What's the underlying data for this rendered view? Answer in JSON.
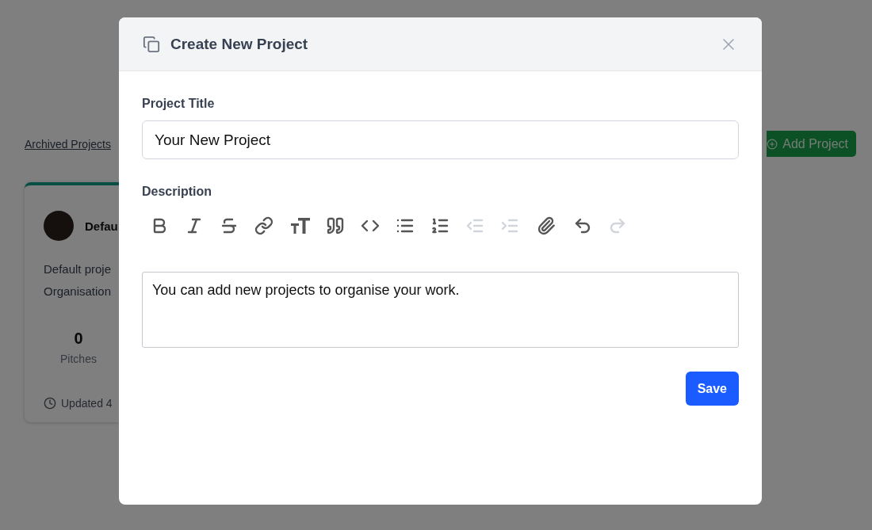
{
  "background": {
    "archived_link": "Archived Projects",
    "add_button": "Add Project",
    "card": {
      "title": "Defau",
      "description_lines": [
        "Default proje",
        "Organisation"
      ],
      "stat_value": "0",
      "stat_label": "Pitches",
      "updated": "Updated 4"
    }
  },
  "dialog": {
    "title": "Create New Project",
    "title_field": {
      "label": "Project Title",
      "value": "Your New Project"
    },
    "description": {
      "label": "Description",
      "value": "You can add new projects to organise your work.",
      "toolbar_groups": [
        {
          "tools": [
            {
              "kind": "bold",
              "disabled": false
            },
            {
              "kind": "italic",
              "disabled": false
            },
            {
              "kind": "strike",
              "disabled": false
            },
            {
              "kind": "link",
              "disabled": false
            }
          ]
        },
        {
          "tools": [
            {
              "kind": "heading",
              "disabled": false
            },
            {
              "kind": "quote",
              "disabled": false
            },
            {
              "kind": "code",
              "disabled": false
            },
            {
              "kind": "bullets",
              "disabled": false
            },
            {
              "kind": "numbers",
              "disabled": false
            },
            {
              "kind": "outdent",
              "disabled": true
            },
            {
              "kind": "indent",
              "disabled": true
            }
          ]
        },
        {
          "tools": [
            {
              "kind": "attach",
              "disabled": false
            }
          ]
        },
        {
          "tools": [
            {
              "kind": "undo",
              "disabled": false
            },
            {
              "kind": "redo",
              "disabled": true
            }
          ]
        }
      ]
    },
    "save_button": "Save"
  }
}
